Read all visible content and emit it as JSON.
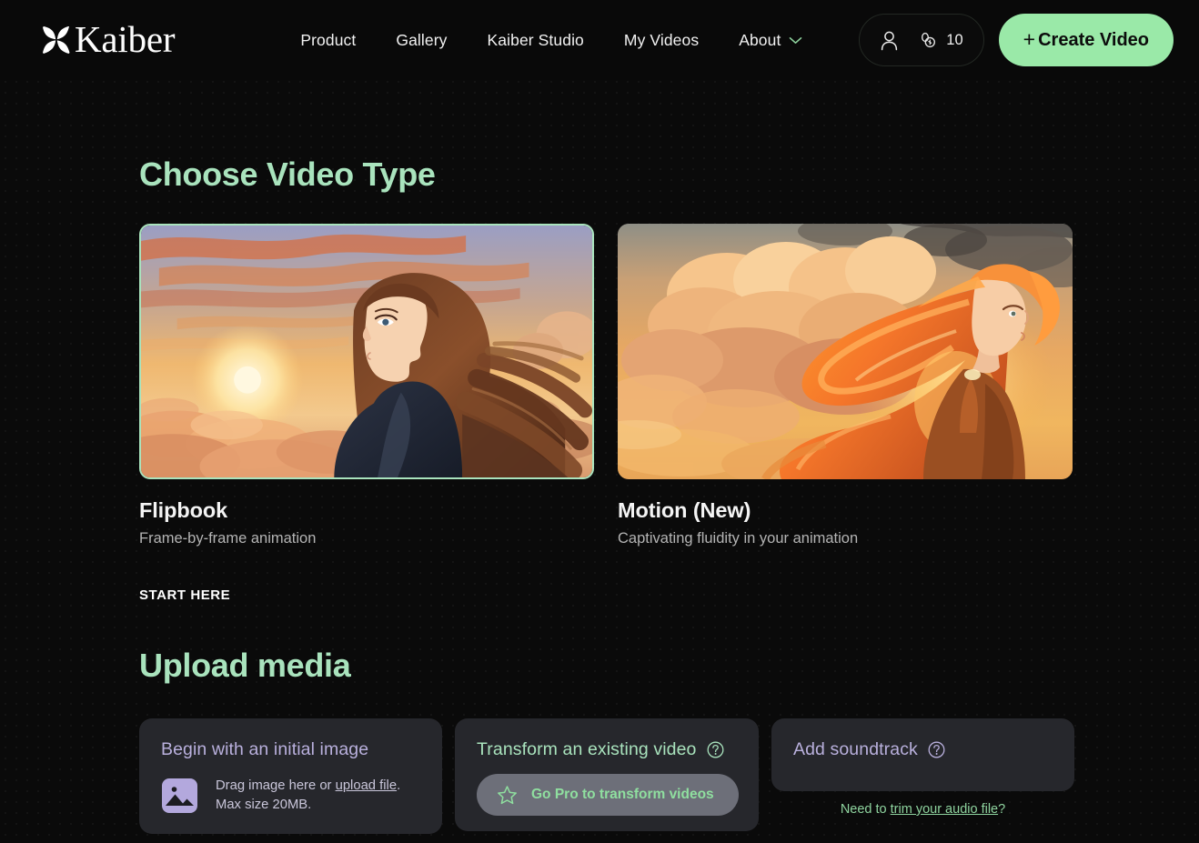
{
  "header": {
    "logo_text": "Kaiber",
    "logo_icon": "kaiber-pinwheel-logo-icon",
    "nav": [
      {
        "label": "Product"
      },
      {
        "label": "Gallery"
      },
      {
        "label": "Kaiber Studio"
      },
      {
        "label": "My Videos"
      },
      {
        "label": "About",
        "caret": true
      }
    ],
    "account": {
      "person_icon": "person-icon",
      "coins_icon": "coins-icon",
      "credits": "10"
    },
    "create_button": {
      "plus": "+",
      "label": "Create Video"
    }
  },
  "main": {
    "choose_title": "Choose Video Type",
    "video_types": [
      {
        "name": "Flipbook",
        "description": "Frame-by-frame animation",
        "selected": true,
        "thumb_alt": "anime-girl-sunset-above-clouds"
      },
      {
        "name": "Motion (New)",
        "description": "Captivating fluidity in your animation",
        "selected": false,
        "thumb_alt": "orange-haired-woman-golden-clouds"
      }
    ],
    "start_here": "START HERE",
    "upload_title": "Upload media",
    "panels": {
      "initial_image": {
        "title": "Begin with an initial image",
        "icon": "image-placeholder-icon",
        "drop_prefix": "Drag image here or ",
        "upload_link": "upload file",
        "drop_suffix": ".",
        "max_size": "Max size 20MB."
      },
      "transform_video": {
        "title": "Transform an existing video",
        "help_icon": "help-circle-icon",
        "gopro_icon": "star-icon",
        "gopro_label": "Go Pro to transform videos"
      },
      "add_soundtrack": {
        "title": "Add soundtrack",
        "help_icon": "help-circle-icon",
        "trim_prefix": "Need to ",
        "trim_link": "trim your audio file",
        "trim_suffix": "?"
      }
    }
  },
  "colors": {
    "accent_green": "#a9e3bd",
    "button_green": "#9ae9a8",
    "lavender": "#b9b0dd",
    "panel_bg": "#26272c",
    "page_bg": "#0a0a0a"
  }
}
